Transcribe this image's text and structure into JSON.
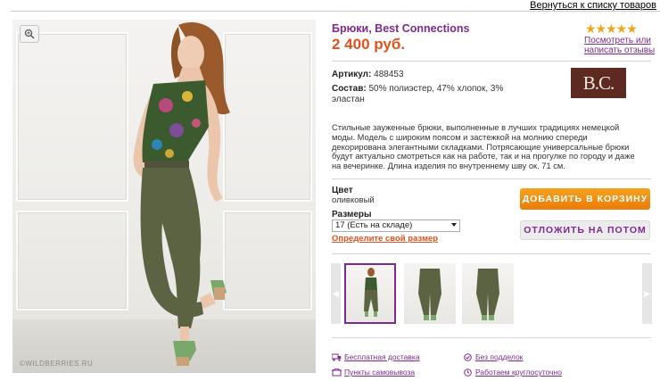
{
  "header": {
    "back_link": "Вернуться к списку товаров"
  },
  "photo": {
    "watermark": "©WILDBERRIES.RU",
    "zoom_icon": "zoom-in-icon"
  },
  "product": {
    "title": "Брюки, Best Connections",
    "price": "2 400 руб.",
    "rating_stars": 5,
    "stars_text": "★★★★★",
    "reviews_link": "Посмотреть или написать отзывы",
    "article_label": "Артикул:",
    "article_value": "488453",
    "composition_label": "Состав:",
    "composition_value": "50% полиэстер, 47% хлопок, 3% эластан",
    "brand_logo": "B.C.",
    "description": "Стильные зауженные брюки, выполненные в лучших традициях немецкой моды. Модель с широким поясом и застежкой на молнию спереди декорирована элегантными складками. Потрясающие универсальные брюки будут актуально смотреться как на работе, так и на прогулке по городу и даже на вечеринке. Длина изделия по внутреннему шву ок. 71 см.",
    "color_label": "Цвет",
    "color_value": "оливковый",
    "size_label": "Размеры",
    "size_selected": "17 (Есть на складе)",
    "size_link": "Определите свой размер",
    "add_to_cart": "ДОБАВИТЬ В КОРЗИНУ",
    "save_for_later": "ОТЛОЖИТЬ НА ПОТОМ"
  },
  "thumbnails": {
    "count": 3,
    "active_index": 0
  },
  "features": [
    {
      "label": "Бесплатная доставка",
      "icon": "delivery-truck-icon"
    },
    {
      "label": "Без подделок",
      "icon": "original-badge-icon"
    },
    {
      "label": "Пункты самовывоза",
      "icon": "pickup-point-icon"
    },
    {
      "label": "Работаем круглосуточно",
      "icon": "clock-icon"
    }
  ],
  "colors": {
    "accent_purple": "#7c2a8f",
    "price_orange": "#e0521f",
    "cart_orange": "#f18d13",
    "star_gold": "#f3a31c"
  }
}
